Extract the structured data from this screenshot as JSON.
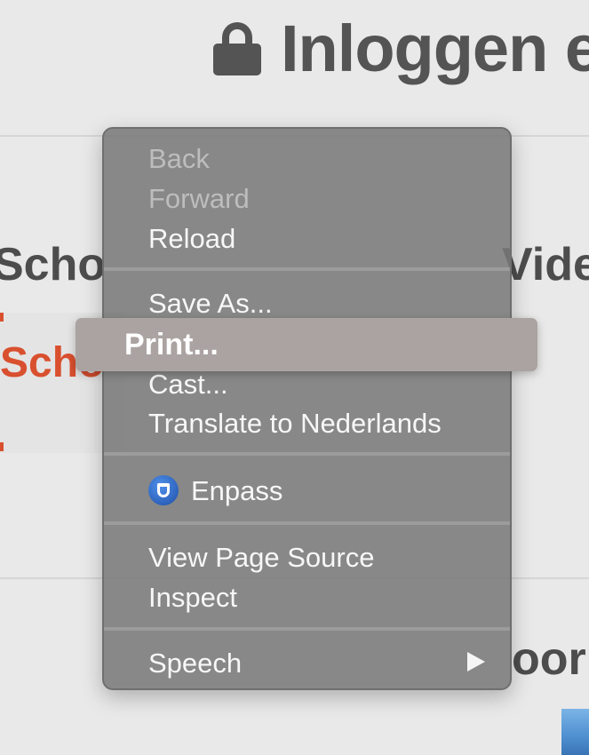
{
  "page": {
    "title": "Inloggen e",
    "left_heading": "Scho",
    "right_heading": "Vide",
    "left_link": "Scho",
    "bottom_right_heading": "oor"
  },
  "context_menu": {
    "items": [
      {
        "label": "Back",
        "enabled": false
      },
      {
        "label": "Forward",
        "enabled": false
      },
      {
        "label": "Reload",
        "enabled": true
      },
      {
        "label": "Save As...",
        "enabled": true
      },
      {
        "label": "Print...",
        "enabled": true,
        "highlighted": true
      },
      {
        "label": "Cast...",
        "enabled": true
      },
      {
        "label": "Translate to Nederlands",
        "enabled": true
      },
      {
        "label": "Enpass",
        "enabled": true,
        "icon": "enpass-icon"
      },
      {
        "label": "View Page Source",
        "enabled": true
      },
      {
        "label": "Inspect",
        "enabled": true
      },
      {
        "label": "Speech",
        "enabled": true,
        "submenu": true
      }
    ]
  },
  "colors": {
    "menu_bg": "#787878",
    "highlight": "#aaa3a1",
    "accent_red": "#d9502f",
    "text_dark": "#4d4d4d"
  }
}
